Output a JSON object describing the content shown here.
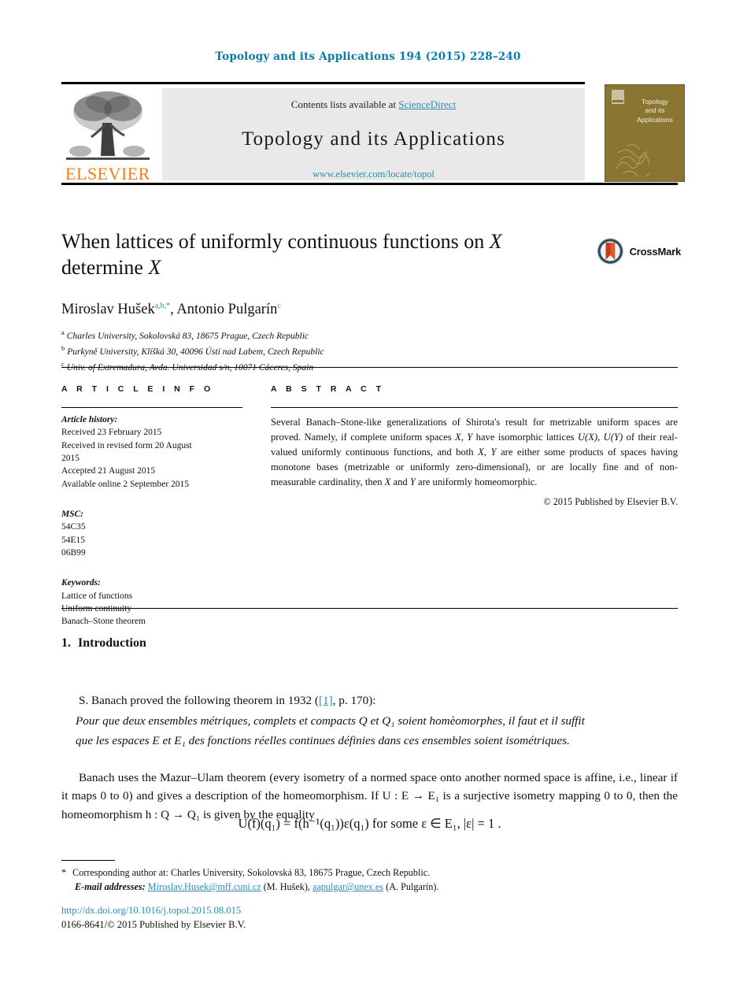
{
  "running_head": "Topology and its Applications 194 (2015) 228–240",
  "masthead": {
    "contents_prefix": "Contents lists available at ",
    "contents_link": "ScienceDirect",
    "journal_title": "Topology and its Applications",
    "journal_url": "www.elsevier.com/locate/topol",
    "publisher_wordmark": "ELSEVIER",
    "cover_title_line1": "Topology",
    "cover_title_line2": "and its",
    "cover_title_line3": "Applications",
    "cover_color": "#8a7632",
    "banner_color": "#e9e9e9",
    "link_color": "#2e8ab5",
    "elsevier_orange": "#ef7c1a"
  },
  "title": {
    "line1_a": "When lattices of uniformly continuous functions on ",
    "line1_math": "X",
    "line2_a": "determine ",
    "line2_math": "X"
  },
  "authors": {
    "author1_name": "Miroslav Hušek",
    "author1_marks": "a,b,*",
    "separator": ", ",
    "author2_name": "Antonio Pulgarín",
    "author2_marks": "c"
  },
  "affiliations": [
    {
      "mark": "a",
      "text": "Charles University, Sokolovská 83, 18675 Prague, Czech Republic"
    },
    {
      "mark": "b",
      "text": "Purkyně University, Klíšká 30, 40096 Ústí nad Labem, Czech Republic"
    },
    {
      "mark": "c",
      "text": "Univ. of Extremadura, Avda. Universidad s/n, 10071 Cáceres, Spain"
    }
  ],
  "crossmark": {
    "label": "CrossMark"
  },
  "article_info": {
    "heading": "A R T I C L E   I N F O",
    "history_label": "Article history:",
    "history": [
      "Received 23 February 2015",
      "Received in revised form 20 August",
      "2015",
      "Accepted 21 August 2015",
      "Available online 2 September 2015"
    ],
    "msc_label": "MSC:",
    "msc": [
      "54C35",
      "54E15",
      "06B99"
    ],
    "keywords_label": "Keywords:",
    "keywords": [
      "Lattice of functions",
      "Uniform continuity",
      "Banach–Stone theorem"
    ]
  },
  "abstract": {
    "heading": "A B S T R A C T",
    "part1": "Several Banach–Stone-like generalizations of Shirota's result for metrizable uniform spaces are proved. Namely, if complete uniform spaces ",
    "m1": "X, Y",
    "part2": " have isomorphic lattices ",
    "m2": "U(X), U(Y)",
    "part3": " of their real-valued uniformly continuous functions, and both ",
    "m3": "X, Y",
    "part4": " are either some products of spaces having monotone bases (metrizable or uniformly zero-dimensional), or are locally fine and of non-measurable cardinality, then ",
    "m4": "X",
    "part5": " and ",
    "m5": "Y",
    "part6": " are uniformly homeomorphic.",
    "copyright": "© 2015 Published by Elsevier B.V."
  },
  "introduction": {
    "number": "1.",
    "heading": "Introduction",
    "para1_a": "S. Banach proved the following theorem in 1932 (",
    "para1_ref": "[1]",
    "para1_b": ", p. 170):",
    "quote_line1": "Pour que deux ensembles métriques, complets et compacts Q et Q₁ soient homèomorphes, il faut et il suffit",
    "quote_line2": "que les espaces E et E₁ des fonctions réelles continues définies dans ces ensembles soient isométriques.",
    "para2": "Banach uses the Mazur–Ulam theorem (every isometry of a normed space onto another normed space is affine, i.e., linear if it maps 0 to 0) and gives a description of the homeomorphism. If U : E → E₁ is a surjective isometry mapping 0 to 0, then the homeomorphism h : Q → Q₁ is given by the equality",
    "equation": "U(f)(q₁) = f(h⁻¹(q₁))ε(q₁)   for some ε ∈ E₁, |ε| = 1 ."
  },
  "footnotes": {
    "star": "*",
    "corresponding": "Corresponding author at: Charles University, Sokolovská 83, 18675 Prague, Czech Republic.",
    "email_label": "E-mail addresses:",
    "email1": "Miroslav.Husek@mff.cuni.cz",
    "email1_owner": " (M. Hušek),",
    "email2": "aapulgar@unex.es",
    "email2_owner": " (A. Pulgarín)."
  },
  "bottom": {
    "doi": "http://dx.doi.org/10.1016/j.topol.2015.08.015",
    "issn": "0166-8641/© 2015 Published by Elsevier B.V."
  }
}
